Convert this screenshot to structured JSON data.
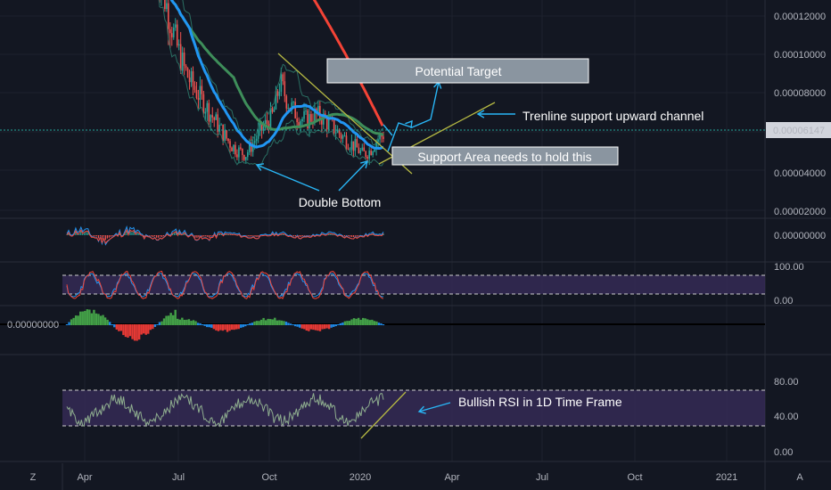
{
  "colors": {
    "background": "#131722",
    "grid": "#1e222d",
    "separator": "#2a2e39",
    "axis_text": "#b2b5be",
    "price_badge_bg": "#d1d4dc",
    "price_badge_text": "#131722",
    "price_line": "#26a69a",
    "candle_up": "#26a69a",
    "candle_down": "#ef5350",
    "ma_blue": "#2196f3",
    "ma_green": "#3e8e5a",
    "ma_red": "#f44336",
    "band": "#2a6f63",
    "annotation_arrow": "#29b6f6",
    "trendline": "#b5b843",
    "rsi_band": "#3a2d5c",
    "rsi_line": "#8fae8f",
    "stoch_k": "#2196f3",
    "stoch_d": "#f44336",
    "label_box_bg": "#8a95a0",
    "label_box_border": "#ffffff"
  },
  "time_axis": {
    "labels": [
      "Apr",
      "Jul",
      "Oct",
      "2020",
      "Apr",
      "Jul",
      "Oct",
      "2021"
    ],
    "left_button": "Z",
    "right_button": "A"
  },
  "chart_data": [
    {
      "type": "candlestick",
      "panel": "price",
      "ylim": [
        1.5e-05,
        0.000135
      ],
      "y_ticks": [
        "0.00012000",
        "0.00010000",
        "0.00008000",
        "0.00004000",
        "0.00002000"
      ],
      "last_price": "0.00006147",
      "series": [
        {
          "name": "",
          "values": [
            0.00016,
            0.00014,
            0.000125,
            0.00011,
            9.8e-05,
            9e-05,
            8.4e-05,
            7.8e-05,
            7.2e-05,
            6.6e-05,
            6e-05,
            5.5e-05,
            5.2e-05,
            5e-05,
            5.6e-05,
            6.2e-05,
            6.7e-05,
            7.2e-05,
            9e-05,
            8e-05,
            7.4e-05,
            7e-05,
            6.9e-05,
            7.2e-05,
            7.1e-05,
            6.7e-05,
            6.4e-05,
            6e-05,
            5.7e-05,
            5.4e-05,
            5e-05,
            5.2e-05,
            5.8e-05,
            6.1e-05
          ]
        }
      ]
    },
    {
      "type": "line",
      "panel": "macd",
      "y_ticks": [
        "0.00000000"
      ]
    },
    {
      "type": "line",
      "panel": "stoch",
      "y_ticks": [
        "100.00",
        "0.00"
      ],
      "levels": [
        80,
        20
      ]
    },
    {
      "type": "line",
      "panel": "momentum",
      "y_ticks": [
        "0.00000000"
      ]
    },
    {
      "type": "line",
      "panel": "rsi",
      "y_ticks": [
        "80.00",
        "40.00",
        "0.00"
      ],
      "levels": [
        70,
        30
      ]
    }
  ],
  "annotations": {
    "potential_target": "Potential Target",
    "trendline_support": "Trenline support upward channel",
    "support_area": "Support Area needs to hold this",
    "double_bottom": "Double Bottom",
    "bullish_rsi": "Bullish RSI in 1D Time Frame"
  }
}
